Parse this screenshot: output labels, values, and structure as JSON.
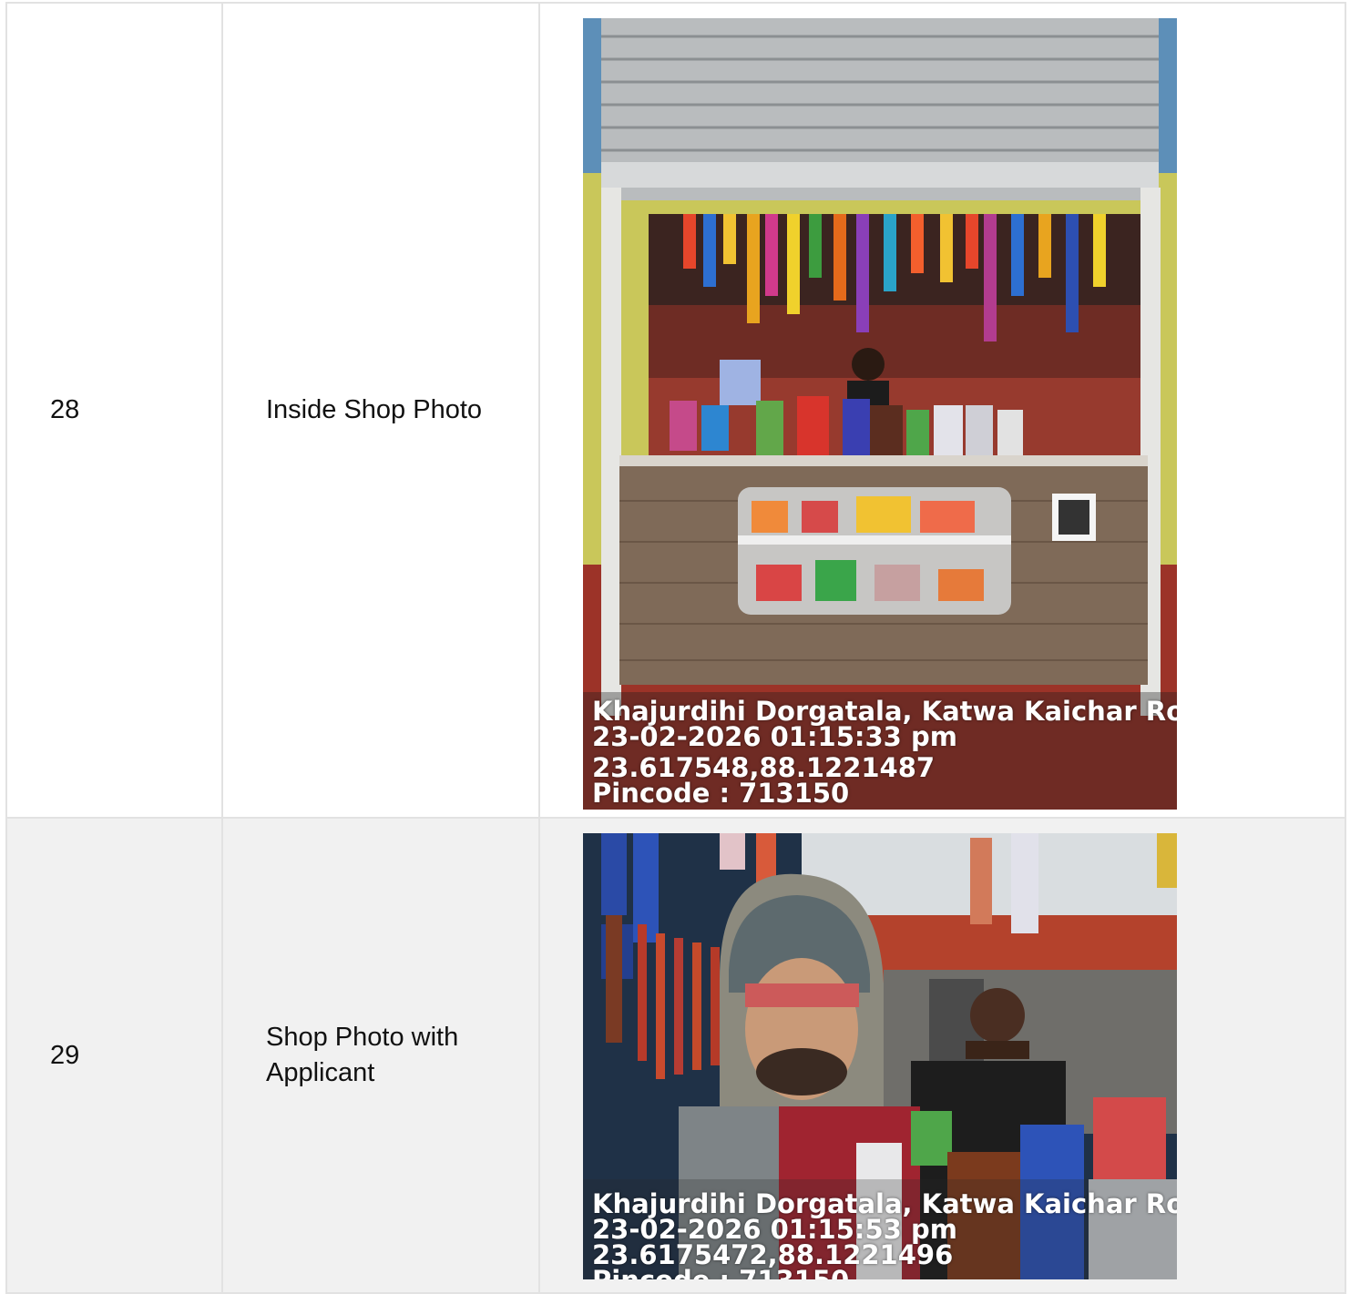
{
  "rows": [
    {
      "number": "28",
      "label": "Inside Shop Photo",
      "photo": {
        "subject": "shop-interior",
        "stamp": {
          "address": "Khajurdihi Dorgatala, Katwa Kaichar Road,",
          "datetime": "23-02-2026 01:15:33 pm",
          "coordinates": "23.617548,88.1221487",
          "pincode": "Pincode : 713150"
        }
      }
    },
    {
      "number": "29",
      "label": "Shop Photo with Applicant",
      "photo": {
        "subject": "selfie-with-shopkeeper",
        "stamp": {
          "address": "Khajurdihi Dorgatala, Katwa Kaichar Road",
          "datetime": "23-02-2026 01:15:53 pm",
          "coordinates": "23.6175472,88.1221496",
          "pincode": "Pincode : 713150"
        }
      }
    }
  ]
}
